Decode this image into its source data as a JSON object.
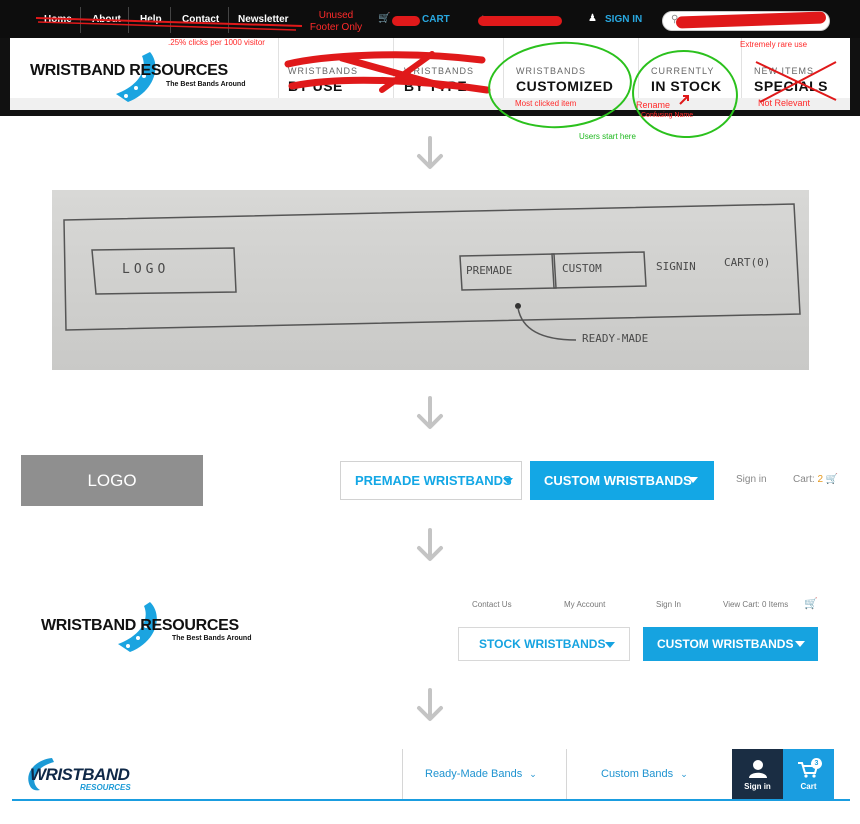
{
  "colors": {
    "brand_blue": "#13a7e5",
    "annotation_red": "#e0191a",
    "annotation_green": "#2bc11d",
    "dark_navy": "#1a2d43",
    "cart_count_orange": "#e6981c"
  },
  "stage1": {
    "top_links": [
      "Home",
      "About",
      "Help",
      "Contact",
      "Newsletter"
    ],
    "unused_note": "Unused\nFooter Only",
    "cart_label": "CART",
    "signin_label": "SIGN IN",
    "search_placeholder": "Se",
    "logo_title": "WRISTBAND RESOURCES",
    "logo_subtitle": "The Best Bands Around",
    "clicks_note": ".25% clicks per 1000 visitor",
    "nav": [
      {
        "small": "WRISTBANDS",
        "big": "BY USE"
      },
      {
        "small": "WRISTBANDS",
        "big": "BY TYPE"
      },
      {
        "small": "WRISTBANDS",
        "big": "CUSTOMIZED"
      },
      {
        "small": "CURRENTLY",
        "big": "IN STOCK"
      },
      {
        "small": "NEW ITEMS",
        "big": "SPECIALS"
      }
    ],
    "notes": {
      "most_clicked": "Most clicked item",
      "users_start": "Users start here",
      "rename": "Rename",
      "confusing": "Confusing Name",
      "rare_use": "Extremely rare use",
      "not_relevant": "Not Relevant"
    }
  },
  "stage2": {
    "logo": "LOGO",
    "premade": "PREMADE",
    "custom": "CUSTOM",
    "signin": "SIGNIN",
    "cart": "CART(0)",
    "ready_made": "READY-MADE"
  },
  "stage3": {
    "logo": "LOGO",
    "premade": "PREMADE WRISTBANDS",
    "custom": "CUSTOM WRISTBANDS",
    "signin": "Sign in",
    "cart_label": "Cart:",
    "cart_count": "2"
  },
  "stage4": {
    "logo_title": "WRISTBAND RESOURCES",
    "logo_subtitle": "The Best Bands Around",
    "contact": "Contact Us",
    "account": "My Account",
    "signin": "Sign In",
    "view_cart": "View Cart: 0 Items",
    "stock": "STOCK WRISTBANDS",
    "custom": "CUSTOM WRISTBANDS"
  },
  "stage5": {
    "logo_title": "WRISTBAND",
    "logo_subtitle": "RESOURCES",
    "ready_made": "Ready-Made Bands",
    "custom": "Custom Bands",
    "signin": "Sign in",
    "cart": "Cart",
    "cart_count": "3"
  }
}
